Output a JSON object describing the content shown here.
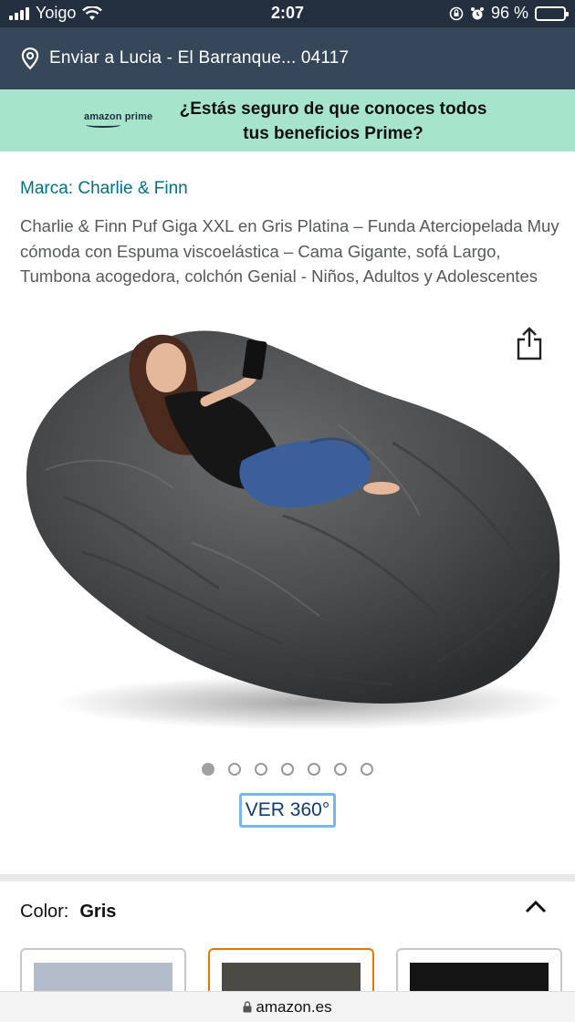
{
  "status_bar": {
    "carrier": "Yoigo",
    "time": "2:07",
    "battery": "96 %",
    "battery_level": 0.96
  },
  "delivery": {
    "text": "Enviar a Lucia - El Barranque... 04117"
  },
  "prime_banner": {
    "logo": "amazon prime",
    "line1": "¿Estás seguro de que conoces todos",
    "line2": "tus beneficios Prime?"
  },
  "product": {
    "brand": "Marca: Charlie & Finn",
    "title": "Charlie & Finn Puf Giga XXL en Gris Platina – Funda Aterciopelada Muy cómoda con Espuma viscoelástica – Cama Gigante, sofá Largo, Tumbona acogedora, colchón Genial - Niños, Adultos y Adolescentes",
    "image_count": 7,
    "active_image_index": 0,
    "view360_label": "VER 360°"
  },
  "color": {
    "label": "Color:",
    "value": "Gris",
    "swatches": [
      {
        "name": "grey-light",
        "color": "#b4bccb",
        "selected": false
      },
      {
        "name": "grey-dark",
        "color": "#4b4a45",
        "selected": true
      },
      {
        "name": "black",
        "color": "#141414",
        "selected": false
      }
    ]
  },
  "url_bar": {
    "url": "amazon.es"
  },
  "colors": {
    "status_bg": "#232f3e",
    "delivery_bg": "#37475a",
    "prime_banner_bg": "#a6e5cc",
    "link": "#007185",
    "selected_swatch": "#e77600"
  }
}
